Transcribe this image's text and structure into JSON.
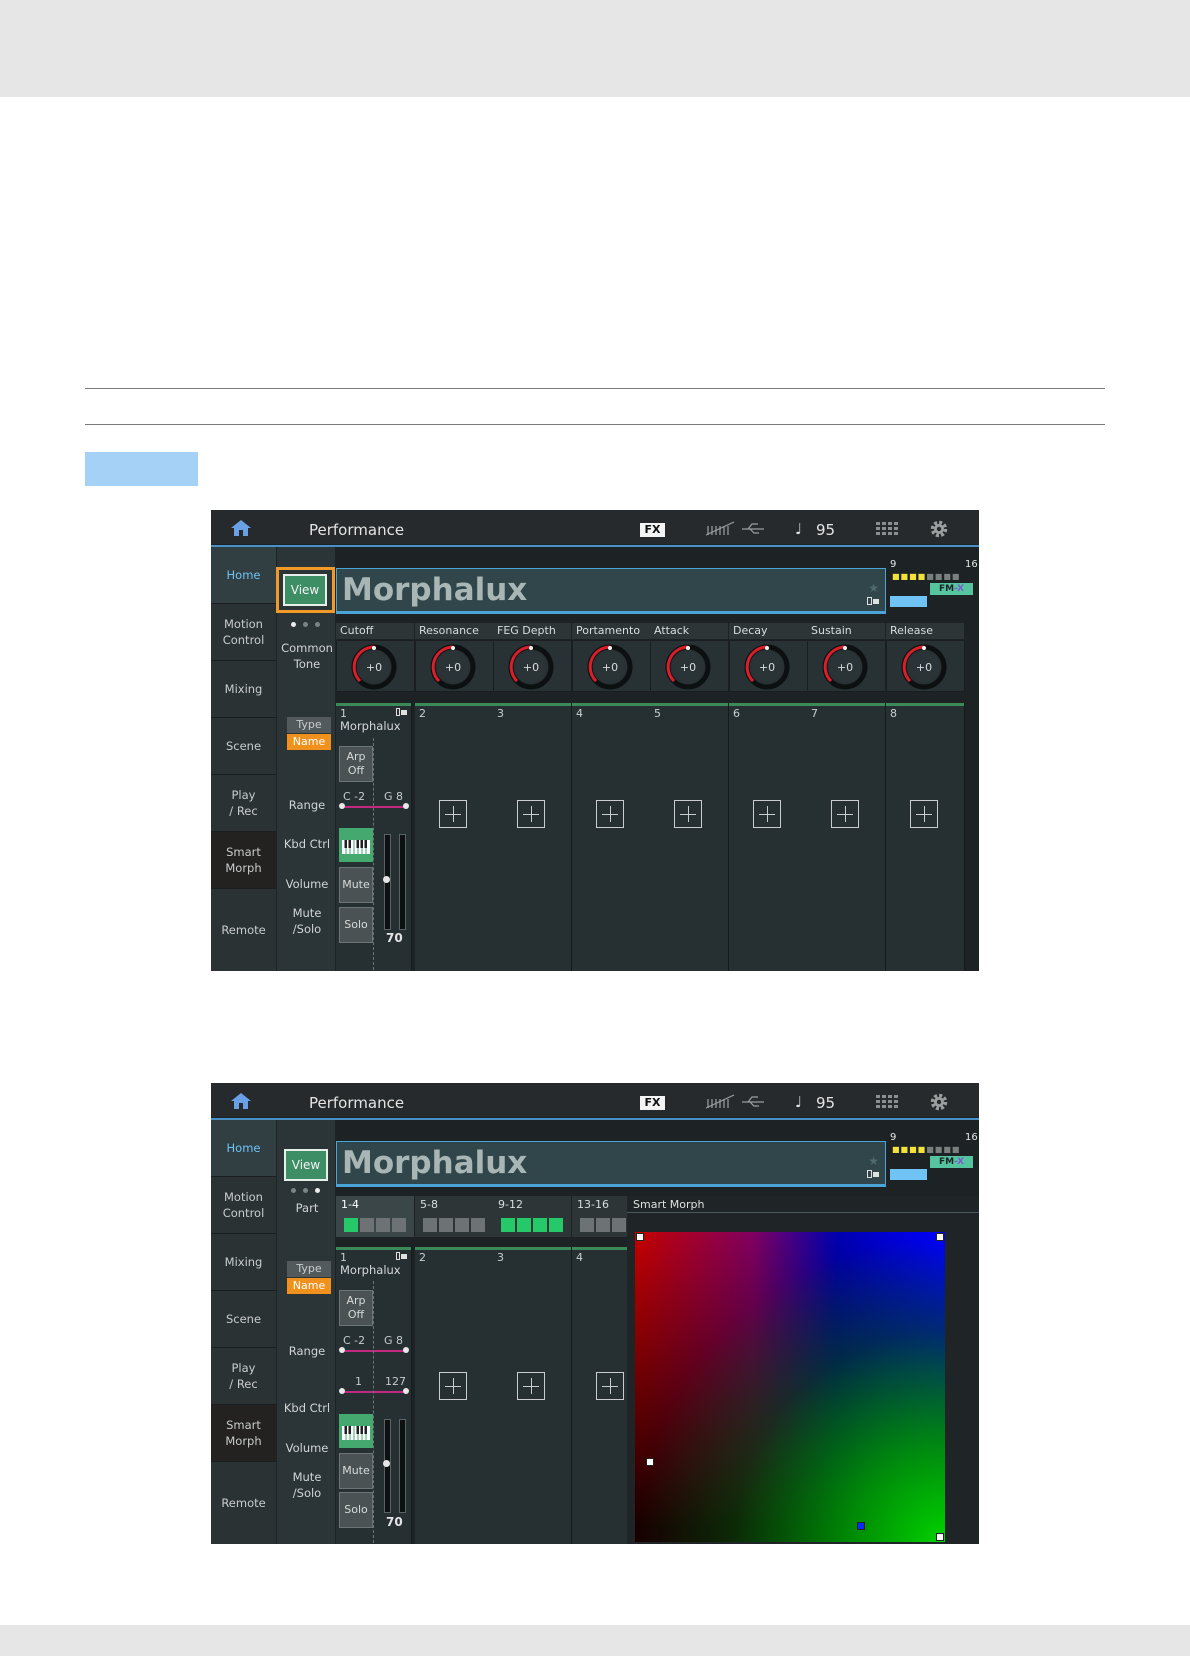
{
  "screen1": {
    "title": "Performance",
    "fx": "FX",
    "tempo_note": "♩",
    "tempo": "95",
    "sidebar": [
      "Home",
      "Motion\nControl",
      "Mixing",
      "Scene",
      "Play\n/ Rec",
      "Smart\nMorph",
      "Remote"
    ],
    "view": "View",
    "perf_name": "Morphalux",
    "status": {
      "start": "9",
      "end": "16",
      "fmx_a": "FM",
      "fmx_b": "-X"
    },
    "labels": {
      "common_tone": "Common\nTone",
      "type": "Type",
      "name": "Name",
      "range": "Range",
      "kbd_ctrl": "Kbd Ctrl",
      "volume": "Volume",
      "mute_solo": "Mute\n/Solo"
    },
    "params": [
      "Cutoff",
      "Resonance",
      "FEG Depth",
      "Portamento",
      "Attack",
      "Decay",
      "Sustain",
      "Release"
    ],
    "knob_value": "+0",
    "parts": [
      "1",
      "2",
      "3",
      "4",
      "5",
      "6",
      "7",
      "8"
    ],
    "part1": {
      "name": "Morphalux",
      "arp": "Arp\nOff",
      "range_low": "C -2",
      "range_high": "G 8",
      "mute": "Mute",
      "solo": "Solo",
      "volume": "70"
    }
  },
  "screen2": {
    "title": "Performance",
    "fx": "FX",
    "tempo_note": "♩",
    "tempo": "95",
    "sidebar": [
      "Home",
      "Motion\nControl",
      "Mixing",
      "Scene",
      "Play\n/ Rec",
      "Smart\nMorph",
      "Remote"
    ],
    "view": "View",
    "perf_name": "Morphalux",
    "status": {
      "start": "9",
      "end": "16",
      "fmx_a": "FM",
      "fmx_b": "-X"
    },
    "labels": {
      "part": "Part",
      "type": "Type",
      "name": "Name",
      "range": "Range",
      "kbd_ctrl": "Kbd Ctrl",
      "volume": "Volume",
      "mute_solo": "Mute\n/Solo"
    },
    "groups": [
      {
        "label": "1-4",
        "active": [
          true,
          false,
          false,
          false
        ]
      },
      {
        "label": "5-8",
        "active": [
          false,
          false,
          false,
          false
        ]
      },
      {
        "label": "9-12",
        "active": [
          true,
          true,
          true,
          true
        ]
      },
      {
        "label": "13-16",
        "active": [
          false,
          false,
          false,
          false
        ]
      }
    ],
    "parts": [
      "1",
      "2",
      "3",
      "4"
    ],
    "part1": {
      "name": "Morphalux",
      "arp": "Arp\nOff",
      "range_low": "C -2",
      "range_high": "G 8",
      "vel_low": "1",
      "vel_high": "127",
      "mute": "Mute",
      "solo": "Solo",
      "volume": "70"
    },
    "smart_morph": "Smart Morph"
  },
  "colors": {
    "accent_blue": "#4aa4d8",
    "view_green": "#3d8d65",
    "highlight_orange": "#f29a27",
    "name_orange": "#f0911e",
    "range_magenta": "#c2287f",
    "part_green": "#26c969"
  }
}
